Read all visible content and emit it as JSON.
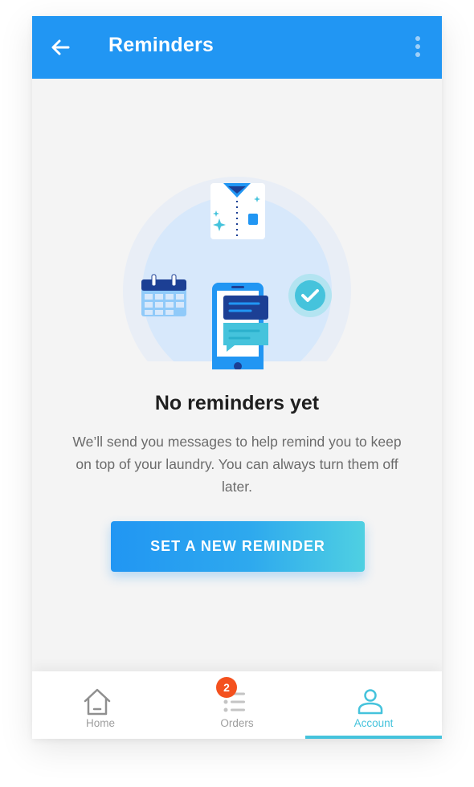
{
  "appbar": {
    "title": "Reminders",
    "back_icon": "arrow-left-icon",
    "menu_icon": "more-vertical-icon"
  },
  "empty_state": {
    "title": "No reminders yet",
    "description": "We’ll send you messages to help remind you to keep on top of your laundry. You can always turn them off later.",
    "illustration_icons": [
      "shirt-icon",
      "calendar-icon",
      "phone-messages-icon",
      "check-circle-icon"
    ]
  },
  "cta": {
    "label": "SET A NEW REMINDER"
  },
  "bottom_nav": {
    "items": [
      {
        "label": "Home",
        "icon": "home-icon",
        "active": false
      },
      {
        "label": "Orders",
        "icon": "list-icon",
        "active": false,
        "badge": "2"
      },
      {
        "label": "Account",
        "icon": "user-icon",
        "active": true
      }
    ]
  },
  "colors": {
    "primary": "#2196f3",
    "accent": "#45c3dc",
    "badge": "#f4511e",
    "background": "#f4f4f4"
  }
}
